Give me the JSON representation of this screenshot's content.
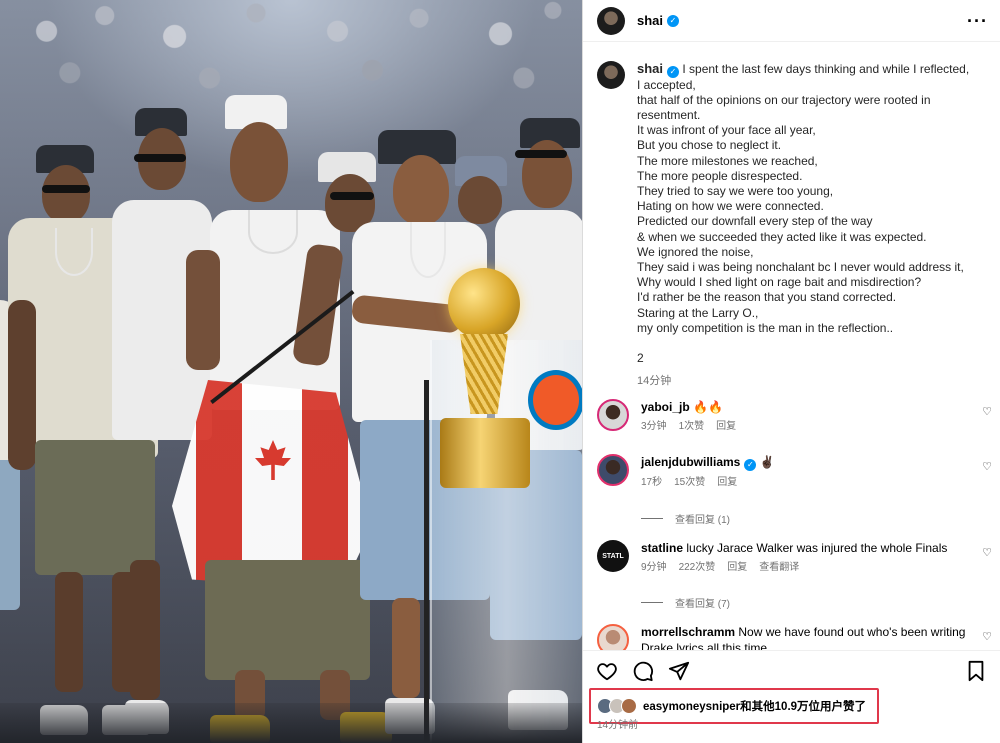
{
  "post": {
    "author": "shai",
    "verified": true,
    "more_icon": "more-horizontal-icon"
  },
  "caption": {
    "user": "shai",
    "lines": [
      "I spent the last few days thinking and while I reflected,",
      "I accepted,",
      "that half of the opinions on our trajectory were rooted in",
      "resentment.",
      "It was infront of your face all year,",
      "But you chose to neglect it.",
      "The more milestones we reached,",
      "The more people disrespected.",
      "They tried to say we were too young,",
      "Hating on how we were connected.",
      "Predicted our downfall every step of the way",
      "& when we succeeded they acted like it was expected.",
      "We ignored the noise,",
      "They said i was being nonchalant bc I never would address it,",
      "Why would I shed light on rage bait and misdirection?",
      "I'd rather be the reason that you stand corrected.",
      "Staring at the Larry O.,",
      "my only competition is the man in the reflection.."
    ],
    "trailing": "2",
    "time": "14分钟"
  },
  "comments": [
    {
      "user": "yaboi_jb",
      "verified": false,
      "text": "🔥🔥",
      "time": "3分钟",
      "likes": "1次赞",
      "reply": "回复",
      "translate": ""
    },
    {
      "user": "jalenjdubwilliams",
      "verified": true,
      "text": "✌🏿",
      "time": "17秒",
      "likes": "15次赞",
      "reply": "回复",
      "translate": "",
      "view_replies": "查看回复 (1)"
    },
    {
      "user": "statline",
      "verified": false,
      "text": "lucky Jarace Walker was injured the whole Finals",
      "time": "9分钟",
      "likes": "222次赞",
      "reply": "回复",
      "translate": "查看翻译",
      "view_replies": "查看回复 (7)",
      "avatar_text": "STATL"
    },
    {
      "user": "morrellschramm",
      "verified": false,
      "text": "Now we have found out who's been writing Drake lyrics all this time",
      "time": "",
      "likes": "",
      "reply": "",
      "translate": ""
    }
  ],
  "actions": {
    "like_icon": "heart-icon",
    "comment_icon": "comment-icon",
    "share_icon": "send-icon",
    "save_icon": "bookmark-icon"
  },
  "likes_summary": {
    "text": "easymoneysniper和其他10.9万位用户赞了"
  },
  "bottom_time": "14分钟前",
  "colors": {
    "verified_blue": "#0095f6",
    "highlight_red": "#e0384b",
    "muted": "#737373"
  }
}
